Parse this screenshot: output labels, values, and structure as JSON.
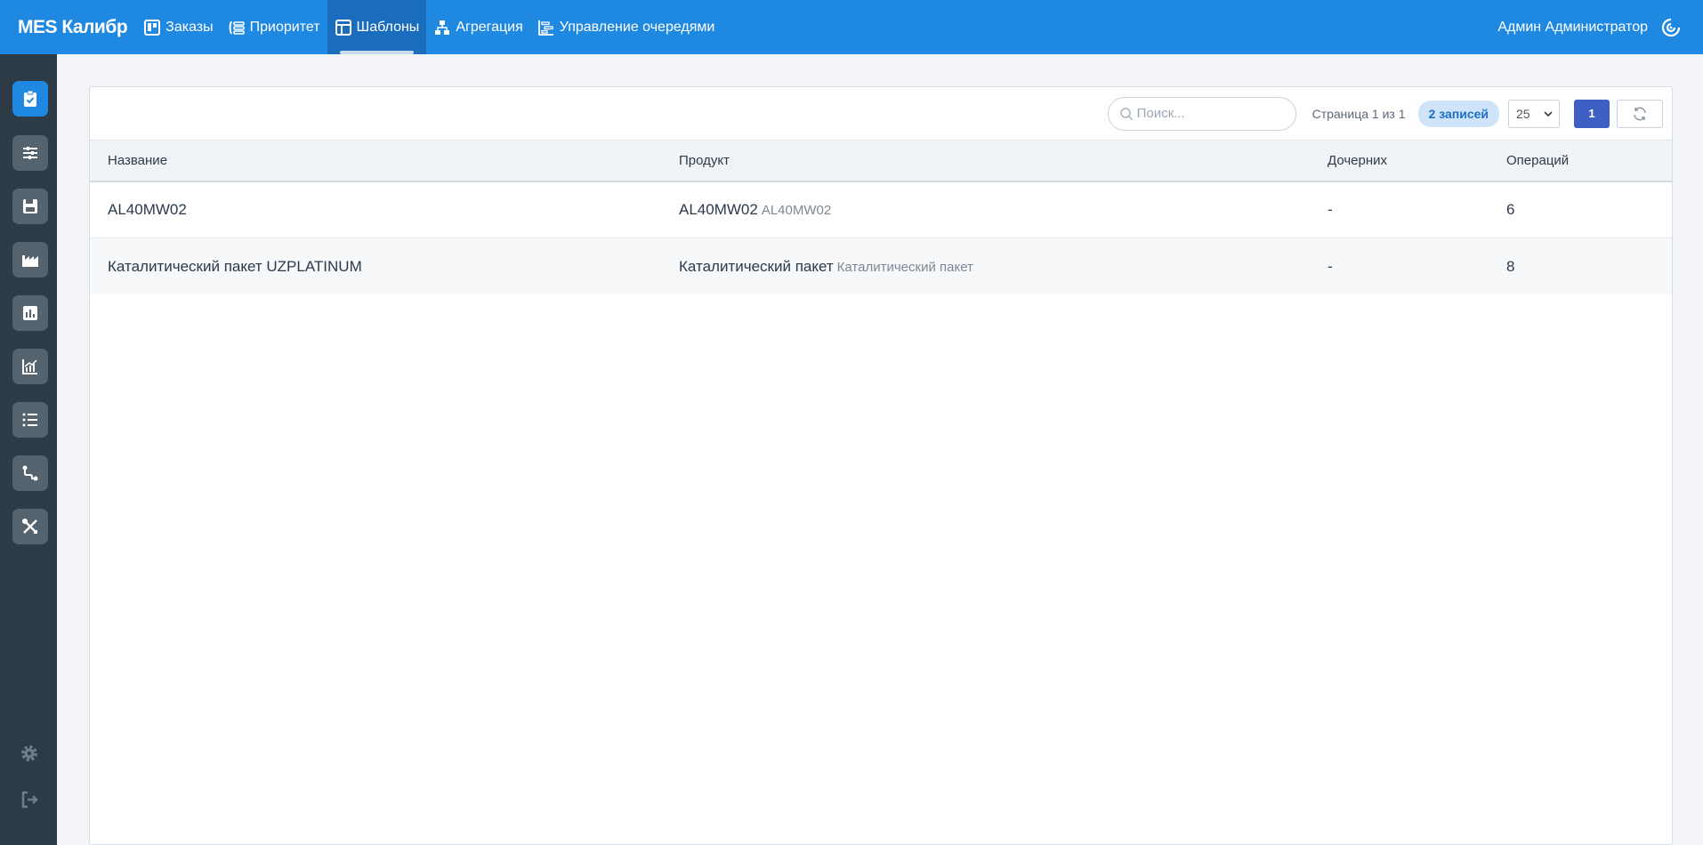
{
  "app": {
    "brand": "MES Калибр"
  },
  "nav": {
    "orders": "Заказы",
    "priority": "Приоритет",
    "templates": "Шаблоны",
    "aggregation": "Агрегация",
    "queues": "Управление очередями"
  },
  "user": {
    "name": "Админ Администратор"
  },
  "toolbar": {
    "search_placeholder": "Поиск...",
    "page_info": "Страница 1 из 1",
    "records_badge": "2 записей",
    "page_size": "25",
    "current_page": "1"
  },
  "table": {
    "columns": [
      "Название",
      "Продукт",
      "Дочерних",
      "Операций"
    ],
    "rows": [
      {
        "name": "AL40MW02",
        "product": "AL40MW02",
        "product_code": "AL40MW02",
        "children": "-",
        "operations": "6"
      },
      {
        "name": "Каталитический пакет UZPLATINUM",
        "product": "Каталитический пакет",
        "product_code": "Каталитический пакет",
        "children": "-",
        "operations": "8"
      }
    ]
  },
  "colors": {
    "accent": "#1f88e0",
    "sidebar": "#2d3b47",
    "page_button": "#3f5fc4"
  }
}
